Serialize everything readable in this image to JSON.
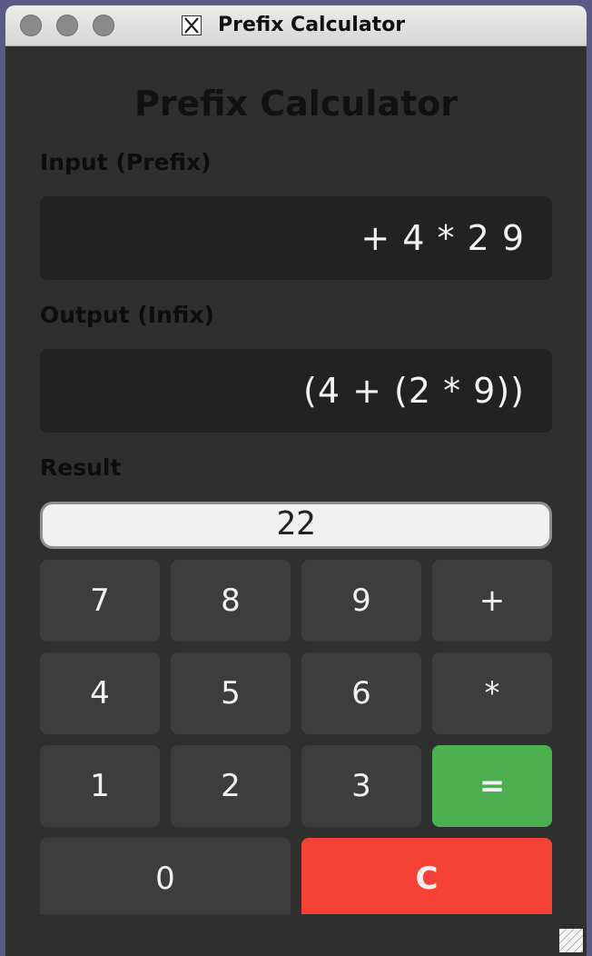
{
  "window": {
    "title": "Prefix Calculator"
  },
  "app": {
    "heading": "Prefix Calculator",
    "input_label": "Input (Prefix)",
    "input_value": "+ 4 * 2 9",
    "output_label": "Output (Infix)",
    "output_value": "(4 + (2 * 9))",
    "result_label": "Result",
    "result_value": "22"
  },
  "keypad": {
    "k7": "7",
    "k8": "8",
    "k9": "9",
    "plus": "+",
    "k4": "4",
    "k5": "5",
    "k6": "6",
    "mult": "*",
    "k1": "1",
    "k2": "2",
    "k3": "3",
    "equals": "=",
    "k0": "0",
    "clear": "C"
  },
  "colors": {
    "background": "#2f2f2f",
    "display": "#222222",
    "key": "#3d3d3d",
    "equals": "#4caf50",
    "clear": "#f44336"
  },
  "icons": [
    "close-icon",
    "minimize-icon",
    "zoom-icon",
    "x11-app-icon",
    "resize-grip-icon"
  ]
}
